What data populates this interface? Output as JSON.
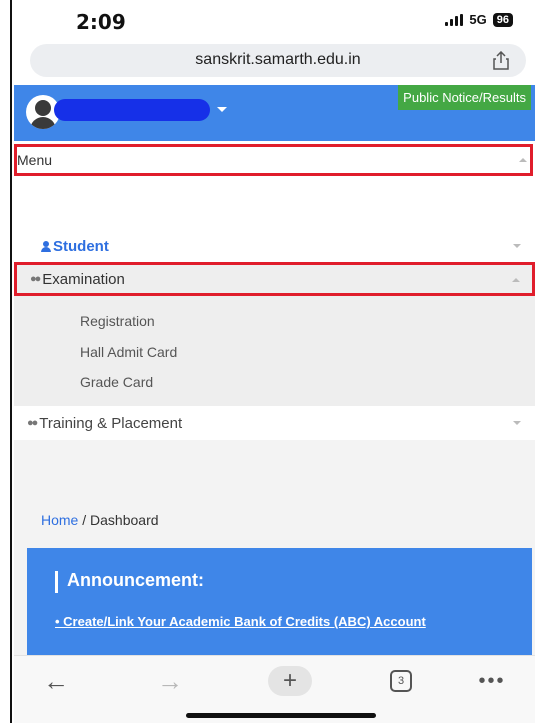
{
  "status_bar": {
    "time": "2:09",
    "network": "5G",
    "battery": "96"
  },
  "browser": {
    "url": "sanskrit.samarth.edu.in",
    "tab_count": "3"
  },
  "header": {
    "notice_button": "Public Notice/Results"
  },
  "menu": {
    "title": "Menu",
    "items": [
      {
        "label": "Student"
      },
      {
        "label": "Examination",
        "subitems": [
          "Registration",
          "Hall Admit Card",
          "Grade Card"
        ]
      },
      {
        "label": "Training & Placement"
      }
    ]
  },
  "breadcrumb": {
    "home": "Home",
    "separator": " / ",
    "current": "Dashboard"
  },
  "announcement": {
    "title": "Announcement:",
    "link": "• Create/Link Your Academic Bank of Credits (ABC) Account"
  },
  "icons": {
    "user": "user-avatar-icon",
    "share": "share-icon",
    "student": "person-icon",
    "group": "group-icon"
  },
  "colors": {
    "header_blue": "#3f86e8",
    "notice_green": "#44a844",
    "highlight_red": "#e01d2b",
    "link_blue": "#2e6fe0"
  }
}
